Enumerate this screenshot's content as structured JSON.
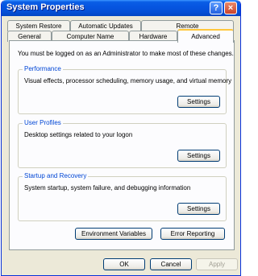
{
  "window": {
    "title": "System Properties"
  },
  "titlebar_buttons": {
    "help": "?",
    "close": "×"
  },
  "tabs": [
    {
      "label": "System Restore"
    },
    {
      "label": "Automatic Updates"
    },
    {
      "label": "Remote"
    },
    {
      "label": "General"
    },
    {
      "label": "Computer Name"
    },
    {
      "label": "Hardware"
    },
    {
      "label": "Advanced",
      "active": true
    }
  ],
  "advanced": {
    "intro": "You must be logged on as an Administrator to make most of these changes.",
    "groups": [
      {
        "label": "Performance",
        "description": "Visual effects, processor scheduling, memory usage, and virtual memory",
        "button": "Settings"
      },
      {
        "label": "User Profiles",
        "description": "Desktop settings related to your logon",
        "button": "Settings"
      },
      {
        "label": "Startup and Recovery",
        "description": "System startup, system failure, and debugging information",
        "button": "Settings"
      }
    ],
    "environment_button": "Environment Variables",
    "error_button": "Error Reporting"
  },
  "footer": {
    "ok": "OK",
    "cancel": "Cancel",
    "apply": "Apply"
  },
  "colors": {
    "accent": "#0046d5",
    "tab_highlight": "#ffc73c",
    "title_bar": "#0654e0"
  }
}
